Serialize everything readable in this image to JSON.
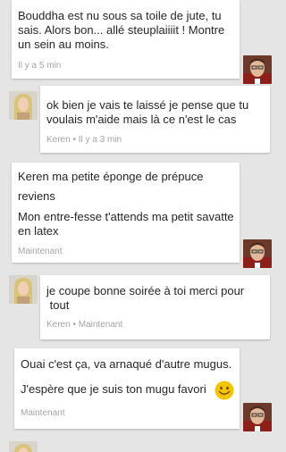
{
  "conversation": {
    "messages": [
      {
        "sender": "self",
        "lines": [
          "Bouddha est nu sous sa toile de jute, tu",
          "sais. Alors bon... allé steuplaiiiit ! Montre",
          "un sein au moins."
        ],
        "meta": "Il y a 5 min"
      },
      {
        "sender": "Keren",
        "lines": [
          "ok bien je vais te laissé je pense que tu",
          "voulais m'aide mais là ce n'est le cas"
        ],
        "meta": "Keren • Il y a 3 min"
      },
      {
        "sender": "self",
        "lines": [
          "Keren ma petite éponge de prépuce",
          "reviens",
          "Mon entre-fesse t'attends ma petit savatte",
          "en latex"
        ],
        "meta": "Maintenant"
      },
      {
        "sender": "Keren",
        "lines": [
          "je coupe bonne soirée à toi merci pour",
          " tout"
        ],
        "meta": "Keren • Maintenant"
      },
      {
        "sender": "self",
        "lines": [
          "Ouai c'est ça, va arnaqué d'autre mugus.",
          "J'espère que je suis ton mugu favori"
        ],
        "emoji": "smiley-emoji",
        "meta": "Maintenant"
      }
    ]
  },
  "icons": {
    "self_avatar": "man-portrait-avatar",
    "keren_avatar": "blonde-woman-avatar"
  },
  "colors": {
    "background": "#e5e5e5",
    "bubble": "#ffffff",
    "text": "#262626",
    "meta": "#a4a4a4",
    "emoji": "#f5c400"
  }
}
